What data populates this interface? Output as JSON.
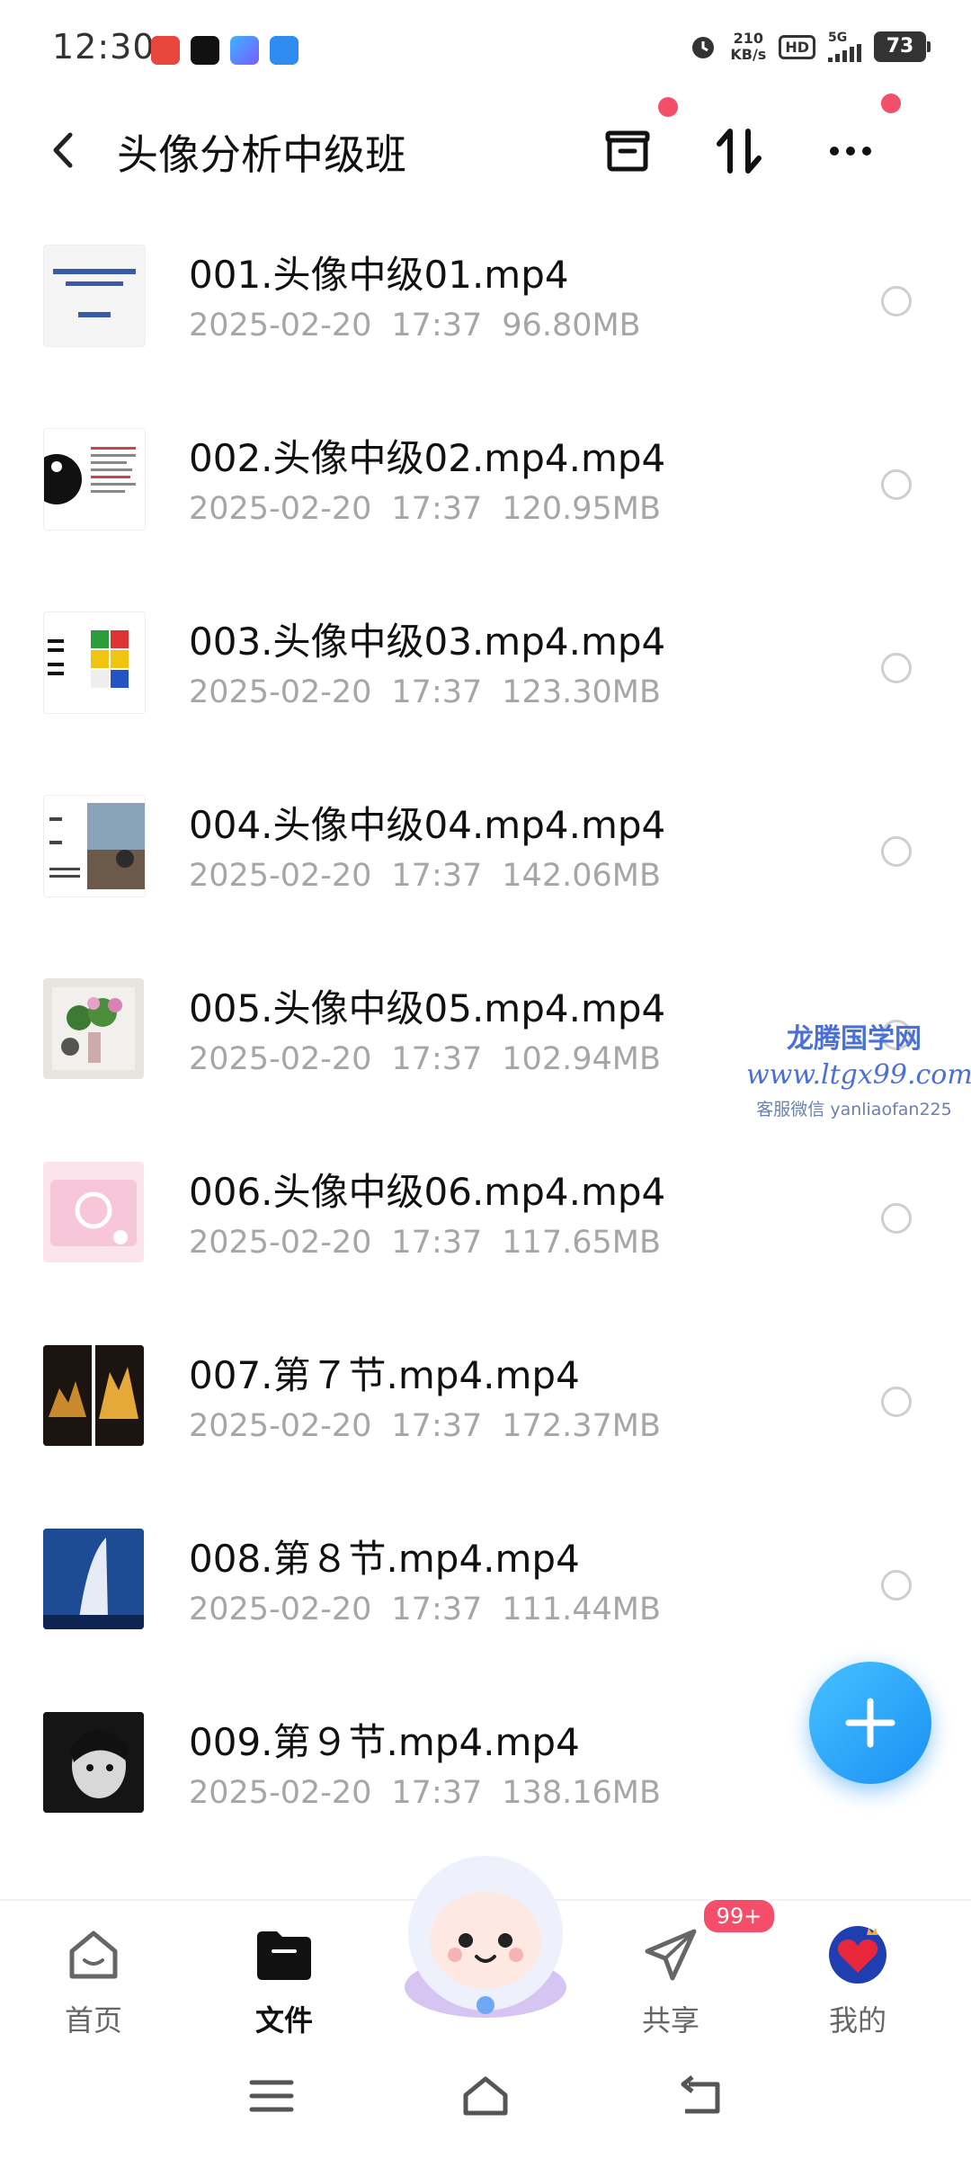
{
  "status_bar": {
    "time": "12:30",
    "net_speed_value": "210",
    "net_speed_unit": "KB/s",
    "hd_label": "HD",
    "network_label": "5G",
    "battery": "73"
  },
  "header": {
    "title": "头像分析中级班",
    "icons": [
      "back-icon",
      "archive-icon",
      "sort-icon",
      "more-icon"
    ]
  },
  "files": [
    {
      "name": "001.头像中级01.mp4",
      "date": "2025-02-20",
      "time": "17:37",
      "size": "96.80MB"
    },
    {
      "name": "002.头像中级02.mp4.mp4",
      "date": "2025-02-20",
      "time": "17:37",
      "size": "120.95MB"
    },
    {
      "name": "003.头像中级03.mp4.mp4",
      "date": "2025-02-20",
      "time": "17:37",
      "size": "123.30MB"
    },
    {
      "name": "004.头像中级04.mp4.mp4",
      "date": "2025-02-20",
      "time": "17:37",
      "size": "142.06MB"
    },
    {
      "name": "005.头像中级05.mp4.mp4",
      "date": "2025-02-20",
      "time": "17:37",
      "size": "102.94MB"
    },
    {
      "name": "006.头像中级06.mp4.mp4",
      "date": "2025-02-20",
      "time": "17:37",
      "size": "117.65MB"
    },
    {
      "name": "007.第７节.mp4.mp4",
      "date": "2025-02-20",
      "time": "17:37",
      "size": "172.37MB"
    },
    {
      "name": "008.第８节.mp4.mp4",
      "date": "2025-02-20",
      "time": "17:37",
      "size": "111.44MB"
    },
    {
      "name": "009.第９节.mp4.mp4",
      "date": "2025-02-20",
      "time": "17:37",
      "size": "138.16MB"
    }
  ],
  "watermark": {
    "line1": "龙腾国学网",
    "line2": "www.ltgx99.com",
    "line3": "客服微信 yanliaofan225"
  },
  "bottom_nav": {
    "home": "首页",
    "files": "文件",
    "share": "共享",
    "mine": "我的",
    "share_badge": "99+"
  },
  "colors": {
    "accent": "#1a8ff5",
    "badge": "#f44e6b",
    "meta_text": "#a6a6a6"
  }
}
